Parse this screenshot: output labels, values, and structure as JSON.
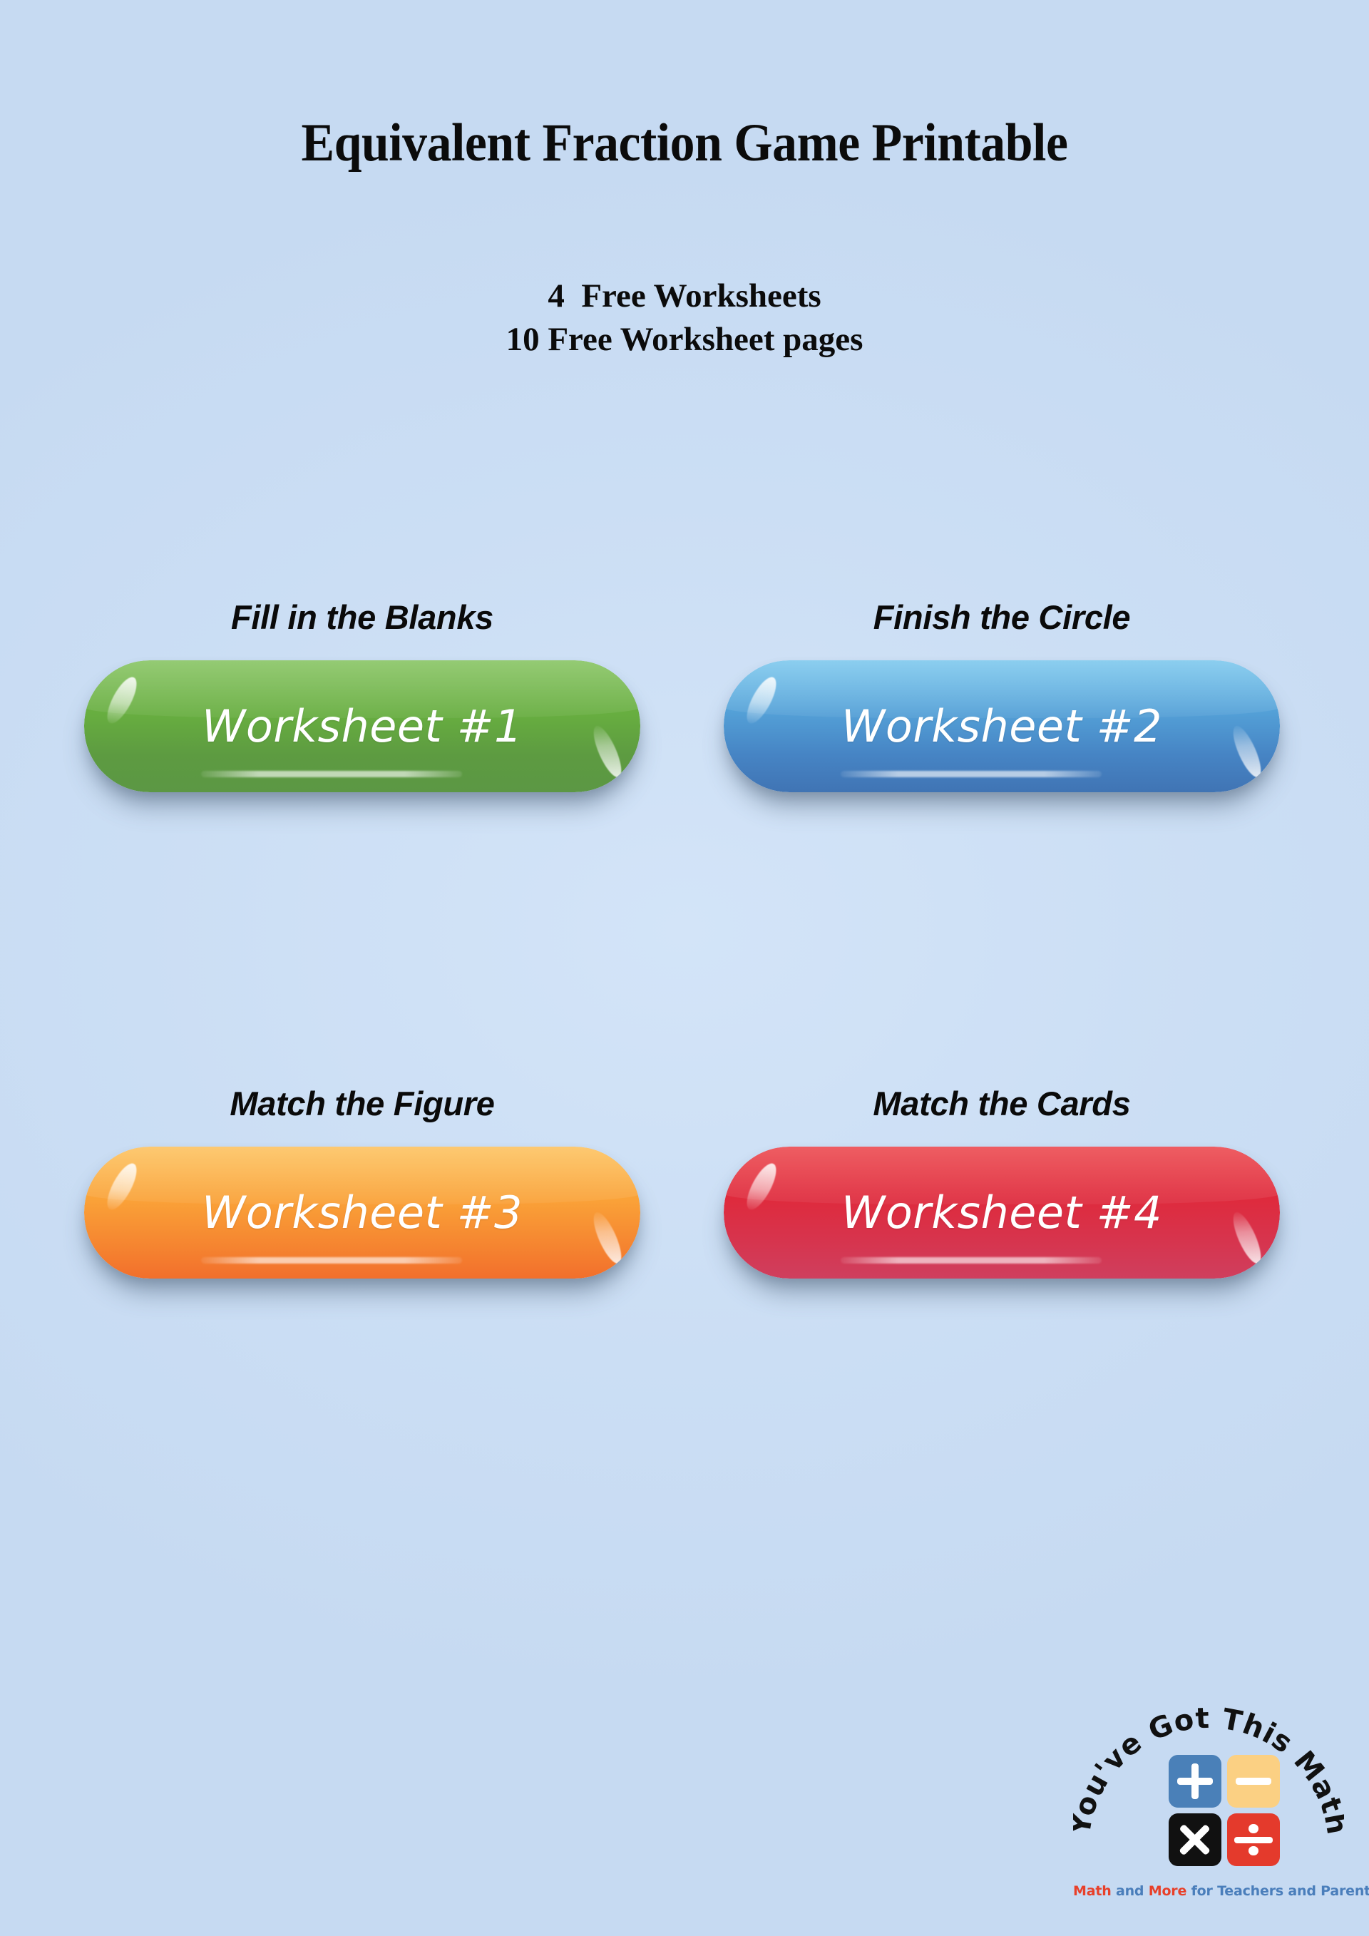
{
  "page": {
    "background_color": "#ccdff5",
    "title": "Equivalent Fraction Game Printable",
    "subtitle_lines": [
      "4  Free Worksheets",
      "10 Free Worksheet pages"
    ]
  },
  "cards": [
    {
      "heading": "Fill in the Blanks",
      "button_label": "Worksheet #1",
      "color_name": "green",
      "color_top": "#6fb843",
      "color_bottom": "#5c9744"
    },
    {
      "heading": "Finish the Circle",
      "button_label": "Worksheet #2",
      "color_name": "blue",
      "color_top": "#63bdea",
      "color_bottom": "#4074b4"
    },
    {
      "heading": "Match the Figure",
      "button_label": "Worksheet #3",
      "color_name": "orange",
      "color_top": "#fcb63f",
      "color_bottom": "#f26f2c"
    },
    {
      "heading": "Match the Cards",
      "button_label": "Worksheet #4",
      "color_name": "red",
      "color_top": "#e8252c",
      "color_bottom": "#cf3f5e"
    }
  ],
  "logo": {
    "arc_text": "You've Got This Math",
    "tiles": [
      {
        "icon": "plus-icon",
        "symbol": "+",
        "background": "#4a80b8"
      },
      {
        "icon": "minus-icon",
        "symbol": "−",
        "background": "#fbd083"
      },
      {
        "icon": "multiply-icon",
        "symbol": "×",
        "background": "#111111"
      },
      {
        "icon": "divide-icon",
        "symbol": "÷",
        "background": "#e43a2c"
      }
    ],
    "tagline_parts": [
      {
        "text": "Math",
        "color": "#e8402a"
      },
      {
        "text": " and ",
        "color": "#4a7ebb"
      },
      {
        "text": "More",
        "color": "#e8402a"
      },
      {
        "text": " for Teachers and Parents",
        "color": "#4a7ebb"
      }
    ],
    "tagline_full": "Math and More for Teachers and Parents"
  }
}
